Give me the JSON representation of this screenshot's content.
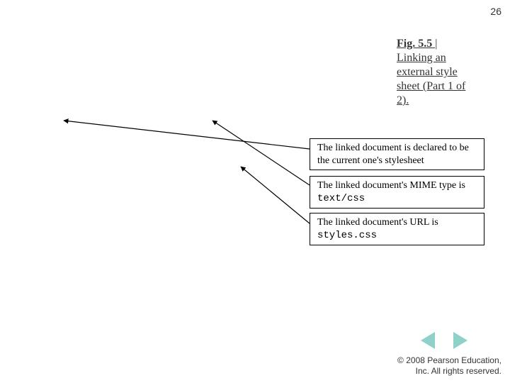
{
  "page_number": "26",
  "caption": {
    "fig_label": "Fig. 5.5",
    "separator": " |",
    "text": "Linking an external style sheet (Part 1 of 2)."
  },
  "callouts": [
    {
      "text": "The linked document is declared to be the current one's stylesheet",
      "code": ""
    },
    {
      "text": "The linked document's MIME type is ",
      "code": "text/css"
    },
    {
      "text": "The linked document's URL is ",
      "code": "styles.css"
    }
  ],
  "footer": {
    "line1": "© 2008 Pearson Education,",
    "line2": "Inc.  All rights reserved."
  }
}
